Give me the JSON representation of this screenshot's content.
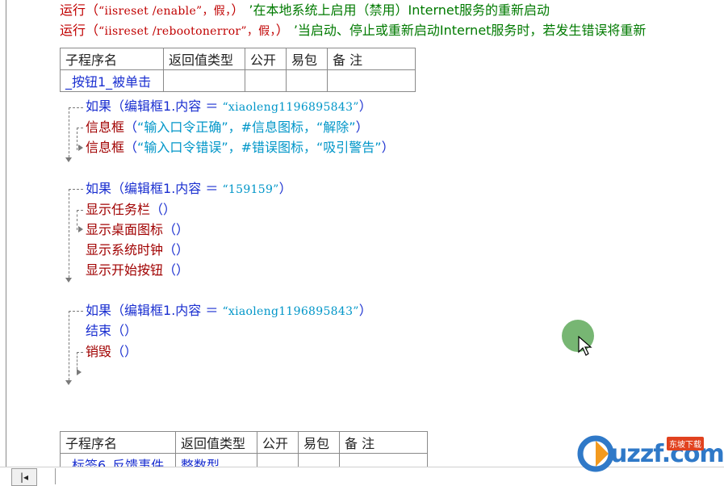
{
  "code": {
    "line1": {
      "call": "运行",
      "open": "（",
      "arg": "“iisreset /enable”，假，",
      "close": "）",
      "comment": "’在本地系统上启用（禁用）Internet服务的重新启动"
    },
    "line2": {
      "call": "运行",
      "open": "（",
      "arg": "“iisreset /rebootonerror”，假，",
      "close": "）",
      "comment": "’当启动、停止或重新启动Internet服务时，若发生错误将重新"
    }
  },
  "table1": {
    "headers": [
      "子程序名",
      "返回值类型",
      "公开",
      "易包",
      "备 注"
    ],
    "row": [
      "_按钮1_被单击",
      "",
      "",
      "",
      ""
    ]
  },
  "blocks": [
    {
      "if_keyword": "如果",
      "if_cond_prefix": "（编辑框1.内容 ＝ ",
      "if_cond_value": "“xiaoleng1196895843”",
      "if_cond_suffix": "）",
      "lines": [
        {
          "name": "信息框",
          "args_open": "（",
          "args": "“输入口令正确”，#信息图标，“解除”",
          "args_close": "）"
        },
        {
          "name": "信息框",
          "args_open": "（",
          "args": "“输入口令错误”，#错误图标，“吸引警告”",
          "args_close": "）"
        }
      ]
    },
    {
      "if_keyword": "如果",
      "if_cond_prefix": "（编辑框1.内容 ＝ ",
      "if_cond_value": "“159159”",
      "if_cond_suffix": "）",
      "lines": [
        {
          "name": "显示任务栏",
          "args": "（）"
        },
        {
          "name": "显示桌面图标",
          "args": "（）"
        },
        {
          "name": "显示系统时钟",
          "args": "（）"
        },
        {
          "name": "显示开始按钮",
          "args": "（）"
        }
      ]
    },
    {
      "if_keyword": "如果",
      "if_cond_prefix": "（编辑框1.内容 ＝ ",
      "if_cond_value": "“xiaoleng1196895843”",
      "if_cond_suffix": "）",
      "lines": [
        {
          "name": "结束",
          "args": "（）"
        },
        {
          "name": "销毁",
          "args": "（）"
        }
      ]
    }
  ],
  "table2": {
    "headers": [
      "子程序名",
      "返回值类型",
      "公开",
      "易包",
      "备 注"
    ],
    "row": [
      "_标签6_反馈事件",
      "整数型",
      "",
      "",
      ""
    ]
  },
  "nav": {
    "prev_label": "|◂"
  },
  "logo": {
    "text": "uzzf.com",
    "badge": "东坡下载"
  },
  "colors": {
    "keyword_red": "#c00000",
    "keyword_blue": "#1a2fd0",
    "string_cyan": "#0096c8",
    "comment_green": "#007a00"
  }
}
